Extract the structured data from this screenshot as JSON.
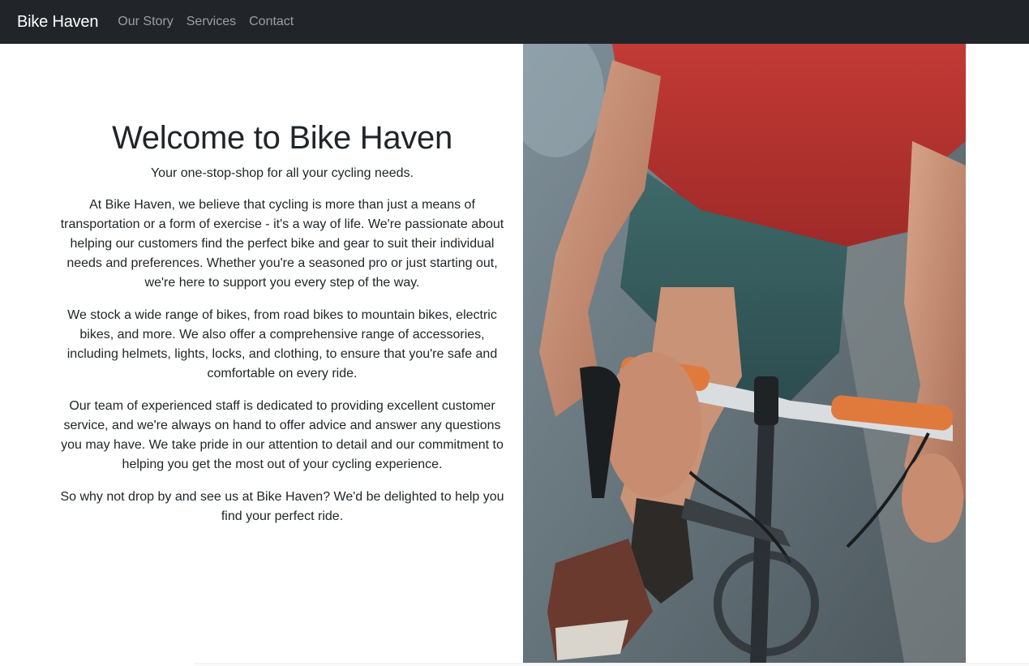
{
  "navbar": {
    "brand": "Bike Haven",
    "links": [
      "Our Story",
      "Services",
      "Contact"
    ]
  },
  "hero": {
    "title": "Welcome to Bike Haven",
    "tagline": "Your one-stop-shop for all your cycling needs.",
    "paragraphs": [
      "At Bike Haven, we believe that cycling is more than just a means of transportation or a form of exercise - it's a way of life. We're passionate about helping our customers find the perfect bike and gear to suit their individual needs and preferences. Whether you're a seasoned pro or just starting out, we're here to support you every step of the way.",
      "We stock a wide range of bikes, from road bikes to mountain bikes, electric bikes, and more. We also offer a comprehensive range of accessories, including helmets, lights, locks, and clothing, to ensure that you're safe and comfortable on every ride.",
      "Our team of experienced staff is dedicated to providing excellent customer service, and we're always on hand to offer advice and answer any questions you may have. We take pride in our attention to detail and our commitment to helping you get the most out of your cycling experience.",
      "So why not drop by and see us at Bike Haven? We'd be delighted to help you find your perfect ride."
    ]
  },
  "colors": {
    "navbar_bg": "#212529",
    "text": "#212529",
    "nav_link": "#8c8f93"
  }
}
